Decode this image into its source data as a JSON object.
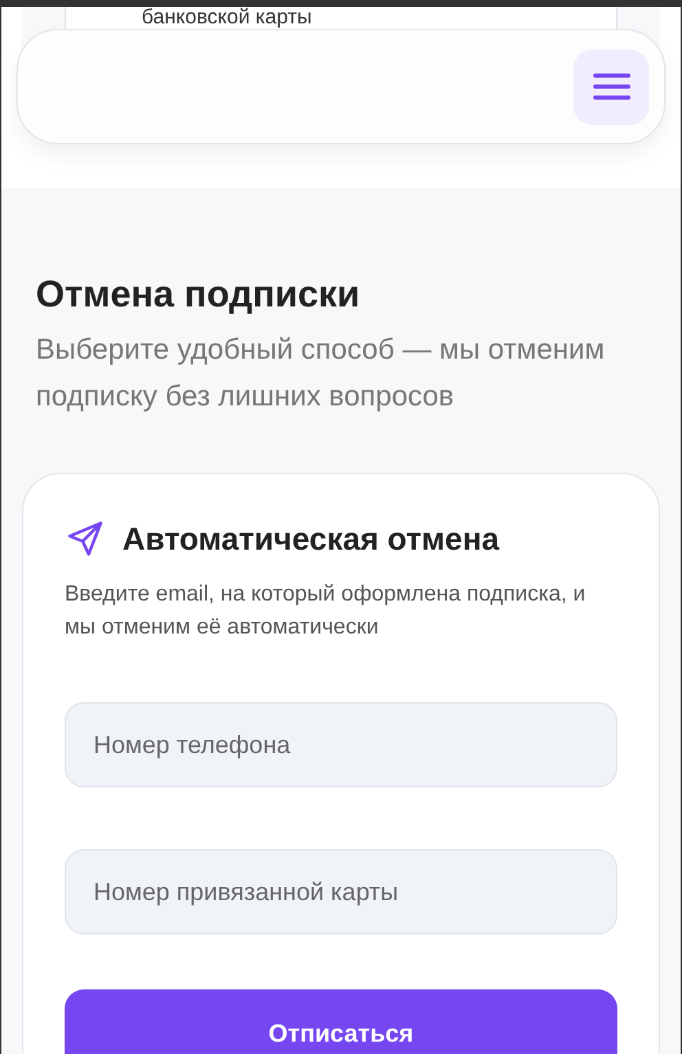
{
  "background_card": {
    "text": "банковской карты"
  },
  "section": {
    "title": "Отмена подписки",
    "subtitle": "Выберите удобный способ — мы отменим подписку без лишних вопросов"
  },
  "form": {
    "title": "Автоматическая отмена",
    "description": "Введите email, на который оформлена подписка, и мы отменим её автоматически",
    "fields": [
      {
        "placeholder": "Номер телефона"
      },
      {
        "placeholder": "Номер привязанной карты"
      }
    ],
    "submit": "Отписаться"
  }
}
